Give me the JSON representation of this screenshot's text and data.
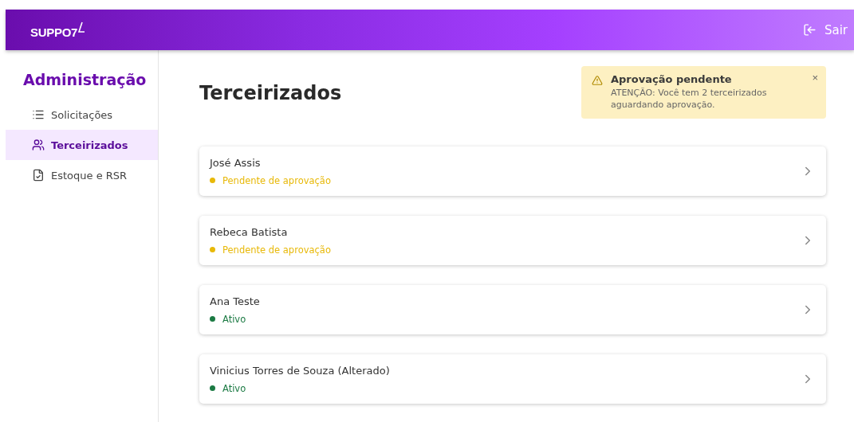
{
  "header": {
    "logo": "SUPPO7",
    "logout": "Sair"
  },
  "sidebar": {
    "title": "Administração",
    "items": [
      {
        "label": "Solicitações",
        "selected": false
      },
      {
        "label": "Terceirizados",
        "selected": true
      },
      {
        "label": "Estoque e RSR",
        "selected": false
      }
    ]
  },
  "page": {
    "title": "Terceirizados"
  },
  "alert": {
    "title": "Aprovação pendente",
    "message": "ATENÇÃO: Você tem 2 terceirizados aguardando aprovação.",
    "close": "×"
  },
  "people": [
    {
      "name": "José Assis",
      "status": "Pendente de aprovação",
      "color": "#e8b909"
    },
    {
      "name": "Rebeca Batista",
      "status": "Pendente de aprovação",
      "color": "#e8b909"
    },
    {
      "name": "Ana Teste",
      "status": "Ativo",
      "color": "#1b7a43"
    },
    {
      "name": "Vinicius Torres de Souza (Alterado)",
      "status": "Ativo",
      "color": "#1b7a43"
    }
  ]
}
